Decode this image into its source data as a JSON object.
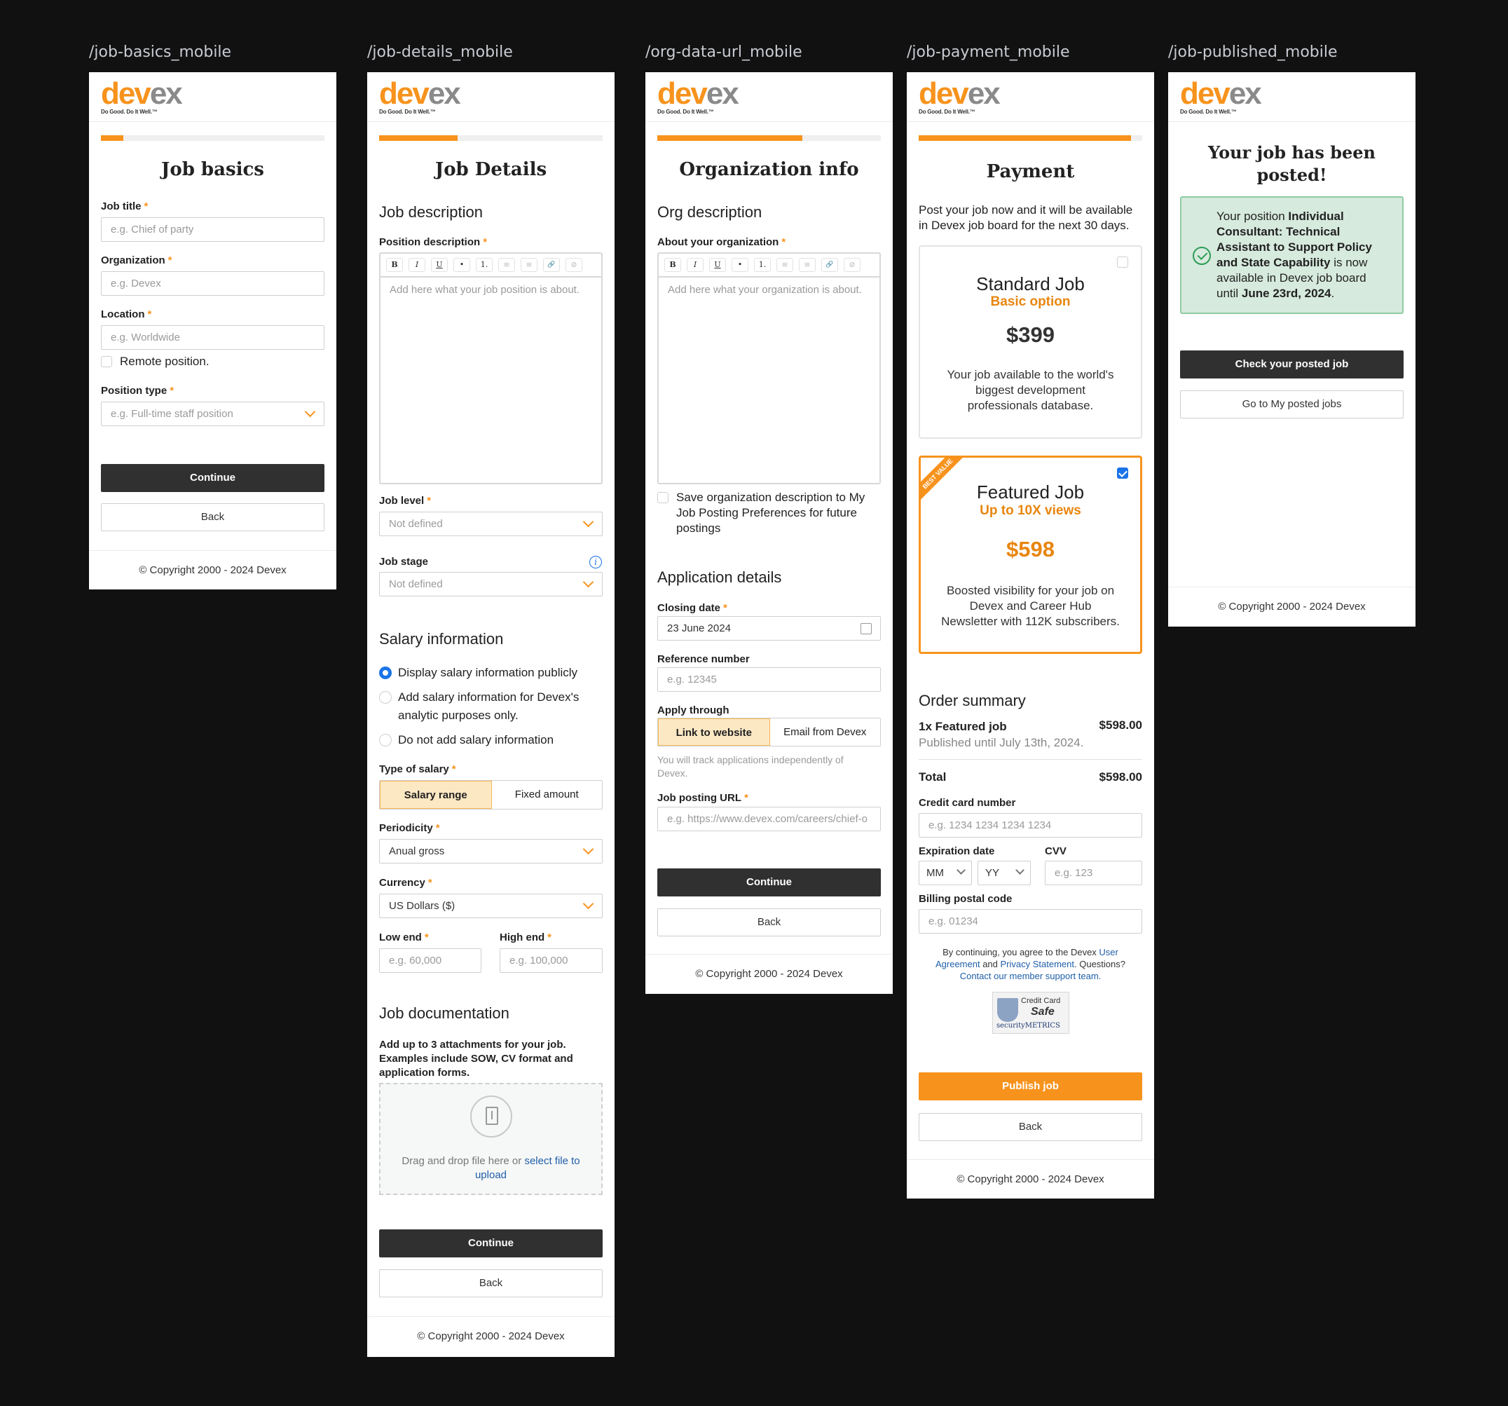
{
  "labels": {
    "s1": "/job-basics_mobile",
    "s2": "/job-details_mobile",
    "s3": "/org-data-url_mobile",
    "s4": "/job-payment_mobile",
    "s5": "/job-published_mobile"
  },
  "brand": {
    "logo_a": "dev",
    "logo_b": "ex",
    "tagline": "Do Good. Do It Well.™",
    "accent": "#f7931d"
  },
  "footer": "© Copyright 2000 - 2024 Devex",
  "common": {
    "continue": "Continue",
    "back": "Back",
    "required": "*"
  },
  "basics": {
    "progress": 0.1,
    "title": "Job basics",
    "job_title_label": "Job title",
    "job_title_ph": "e.g. Chief of party",
    "org_label": "Organization",
    "org_ph": "e.g. Devex",
    "location_label": "Location",
    "location_ph": "e.g. Worldwide",
    "remote_label": "Remote position.",
    "ptype_label": "Position type",
    "ptype_ph": "e.g. Full-time staff position"
  },
  "details": {
    "progress": 0.35,
    "title": "Job Details",
    "jd_section": "Job description",
    "pos_label": "Position description",
    "pos_ph": "Add here what your job position is about.",
    "level_label": "Job level",
    "level_value": "Not defined",
    "stage_label": "Job stage",
    "stage_value": "Not defined",
    "salary_section": "Salary information",
    "radio1": "Display salary information publicly",
    "radio2a": "Add salary information for Devex's",
    "radio2b": "analytic purposes only.",
    "radio3": "Do not add salary information",
    "type_label": "Type of salary",
    "seg1": "Salary range",
    "seg2": "Fixed amount",
    "period_label": "Periodicity",
    "period_value": "Anual gross",
    "currency_label": "Currency",
    "currency_value": "US Dollars ($)",
    "low_label": "Low end",
    "low_ph": "e.g. 60,000",
    "high_label": "High end",
    "high_ph": "e.g. 100,000",
    "doc_section": "Job documentation",
    "doc_hint_a": "Add up to 3 attachments for your job.",
    "doc_hint_b": "Examples include SOW, CV format and",
    "doc_hint_c": "application forms.",
    "drop_text": "Drag and drop file here or ",
    "drop_link_a": "select file to",
    "drop_link_b": "upload"
  },
  "toolbar": [
    "B",
    "I",
    "U",
    "•",
    "1.",
    "≡",
    "≡",
    "🔗",
    "⊘"
  ],
  "org": {
    "progress": 0.65,
    "title": "Organization info",
    "org_section": "Org description",
    "about_label": "About your organization",
    "about_ph": "Add here what your organization is about.",
    "save_a": "Save organization description to My",
    "save_b": "Job Posting Preferences for future",
    "save_c": "postings",
    "app_section": "Application details",
    "closing_label": "Closing date",
    "closing_value": "23 June 2024",
    "ref_label": "Reference number",
    "ref_ph": "e.g. 12345",
    "apply_label": "Apply through",
    "apply1": "Link to website",
    "apply2": "Email from Devex",
    "apply_hint_a": "You will track applications independently of",
    "apply_hint_b": "Devex.",
    "url_label": "Job posting URL",
    "url_ph": "e.g. https://www.devex.com/careers/chief-o"
  },
  "payment": {
    "progress": 0.95,
    "title": "Payment",
    "intro_a": "Post your job now and it will be available",
    "intro_b": "in Devex job board for the next 30 days.",
    "std_title": "Standard Job",
    "std_sub": "Basic option",
    "std_price": "$399",
    "std_desc_a": "Your job available to the world's",
    "std_desc_b": "biggest development",
    "std_desc_c": "professionals database.",
    "ribbon": "BEST VALUE",
    "feat_title": "Featured Job",
    "feat_sub": "Up to 10X views",
    "feat_price": "$598",
    "feat_desc_a": "Boosted visibility for your job on",
    "feat_desc_b": "Devex and Career Hub",
    "feat_desc_c": "Newsletter with 112K subscribers.",
    "order_section": "Order summary",
    "item_name": "1x Featured job",
    "item_price": "$598.00",
    "item_note": "Published until July 13th, 2024.",
    "total_label": "Total",
    "total_value": "$598.00",
    "cc_label": "Credit card number",
    "cc_ph": "e.g. 1234 1234 1234 1234",
    "exp_label": "Expiration date",
    "mm": "MM",
    "yy": "YY",
    "cvv_label": "CVV",
    "cvv_ph": "e.g. 123",
    "zip_label": "Billing postal code",
    "zip_ph": "e.g. 01234",
    "legal_a": "By continuing, you agree to the Devex ",
    "legal_link1a": "User",
    "legal_link1b": "Agreement",
    "legal_and": " and ",
    "legal_link2": "Privacy Statement",
    "legal_q": ". Questions?",
    "legal_link3": "Contact our member support team.",
    "badge_a": "Credit Card",
    "badge_b": "Safe",
    "badge_c": "securityMETRICS",
    "publish": "Publish job"
  },
  "published": {
    "title_a": "Your job has been",
    "title_b": "posted!",
    "msg_a": "Your position ",
    "msg_bold_a": "Individual",
    "msg_bold_b": "Consultant: Technical",
    "msg_bold_c": "Assistant to Support Policy",
    "msg_bold_d": "and State Capability",
    "msg_b": " is now",
    "msg_c": "available in Devex job board",
    "msg_d": "until ",
    "msg_date": "June 23rd, 2024",
    "msg_end": ".",
    "check_btn": "Check your posted job",
    "my_jobs_btn": "Go to My posted jobs"
  }
}
